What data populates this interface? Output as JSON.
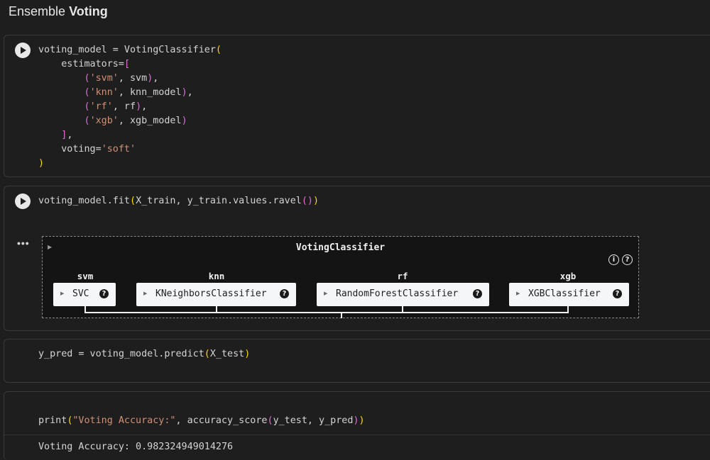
{
  "heading": {
    "prefix": "Ensemble",
    "bold": "Voting"
  },
  "cell1": {
    "lines": [
      [
        "voting_model = VotingClassifier",
        "("
      ],
      [
        "    estimators=",
        "["
      ],
      [
        "        ('svm', svm),"
      ],
      [
        "        ('knn', knn_model),"
      ],
      [
        "        ('rf', rf),"
      ],
      [
        "        ('xgb', xgb_model)"
      ],
      [
        "    ],"
      ],
      [
        "    voting=",
        "'soft'"
      ],
      [
        ")"
      ]
    ]
  },
  "cell2": {
    "code_a": "voting_model.fit",
    "code_b": "X_train, y_train.values.ravel",
    "output_dots": "•••",
    "diagram": {
      "title": "VotingClassifier",
      "info_icon": "i",
      "help_icon": "?",
      "estimators": [
        {
          "label": "svm",
          "name": "SVC"
        },
        {
          "label": "knn",
          "name": "KNeighborsClassifier"
        },
        {
          "label": "rf",
          "name": "RandomForestClassifier"
        },
        {
          "label": "xgb",
          "name": "XGBClassifier"
        }
      ]
    }
  },
  "cell3": {
    "fn": "y_pred = voting_model.predict",
    "arg": "X_test"
  },
  "cell4": {
    "print_fn": "print",
    "string": "\"Voting Accuracy:\"",
    "rest": ", accuracy_score",
    "args": "y_test, y_pred",
    "output": "Voting Accuracy: 0.982324949014276"
  },
  "colors": {
    "background": "#1e1e1e",
    "string": "#ce9178",
    "paren1": "#ffd700",
    "paren2": "#da70d6"
  }
}
